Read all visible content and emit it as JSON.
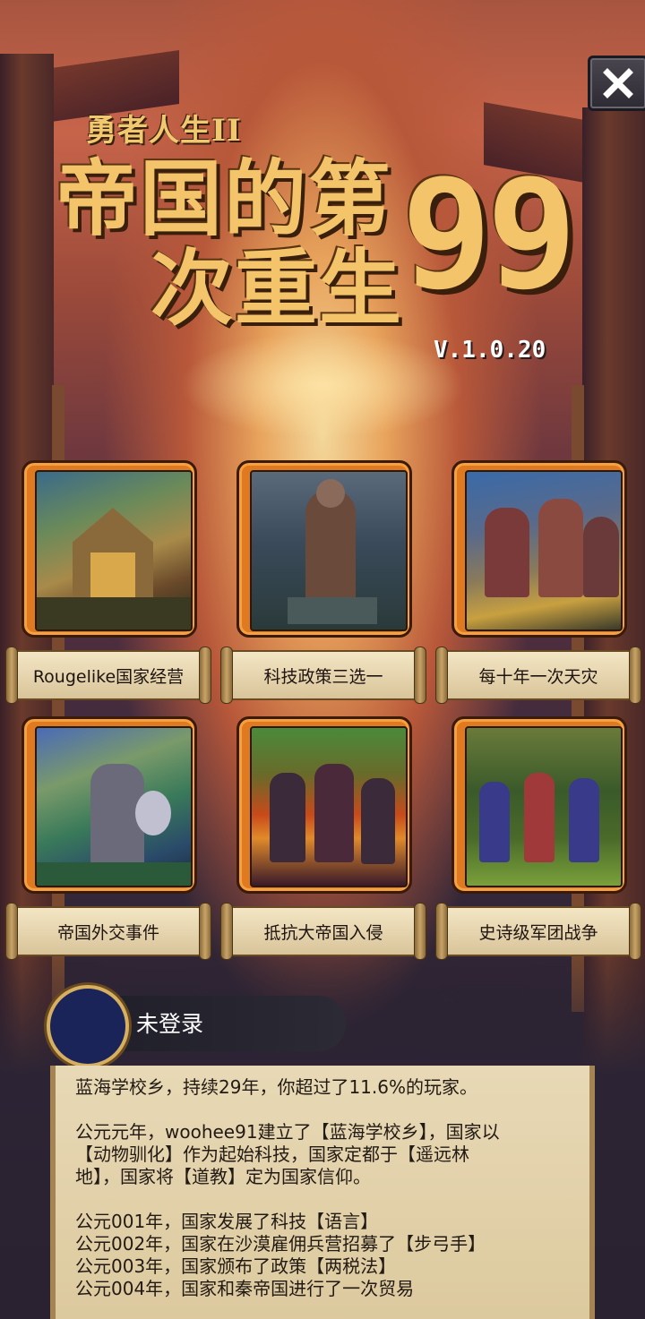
{
  "title": {
    "small": "勇者人生II",
    "line1": "帝国的第",
    "line2": "次重生",
    "number": "99",
    "version": "V.1.0.20"
  },
  "features": [
    {
      "label": "Rougelike国家经营",
      "icon": "village-art"
    },
    {
      "label": "科技政策三选一",
      "icon": "statue-art"
    },
    {
      "label": "每十年一次天灾",
      "icon": "knights-charge-art"
    },
    {
      "label": "帝国外交事件",
      "icon": "knight-duel-art"
    },
    {
      "label": "抵抗大帝国入侵",
      "icon": "burning-battle-art"
    },
    {
      "label": "史诗级军团战争",
      "icon": "army-march-art"
    }
  ],
  "login": {
    "status": "未登录"
  },
  "chronicle": {
    "summary": "蓝海学校乡，持续29年，你超过了11.6%的玩家。",
    "founding": [
      "公元元年，woohee91建立了【蓝海学校乡】，国家以",
      "【动物驯化】作为起始科技，国家定都于【遥远林",
      "地】，国家将【道教】定为国家信仰。"
    ],
    "events": [
      "公元001年，国家发展了科技【语言】",
      "公元002年，国家在沙漠雇佣兵营招募了【步弓手】",
      "公元003年，国家颁布了政策【两税法】",
      "公元004年，国家和秦帝国进行了一次贸易"
    ]
  },
  "colors": {
    "card_frame": "#e07a20",
    "scroll": "#e8d9b6",
    "title_gold": "#f3c46a",
    "avatar_fill": "#1a2458"
  }
}
